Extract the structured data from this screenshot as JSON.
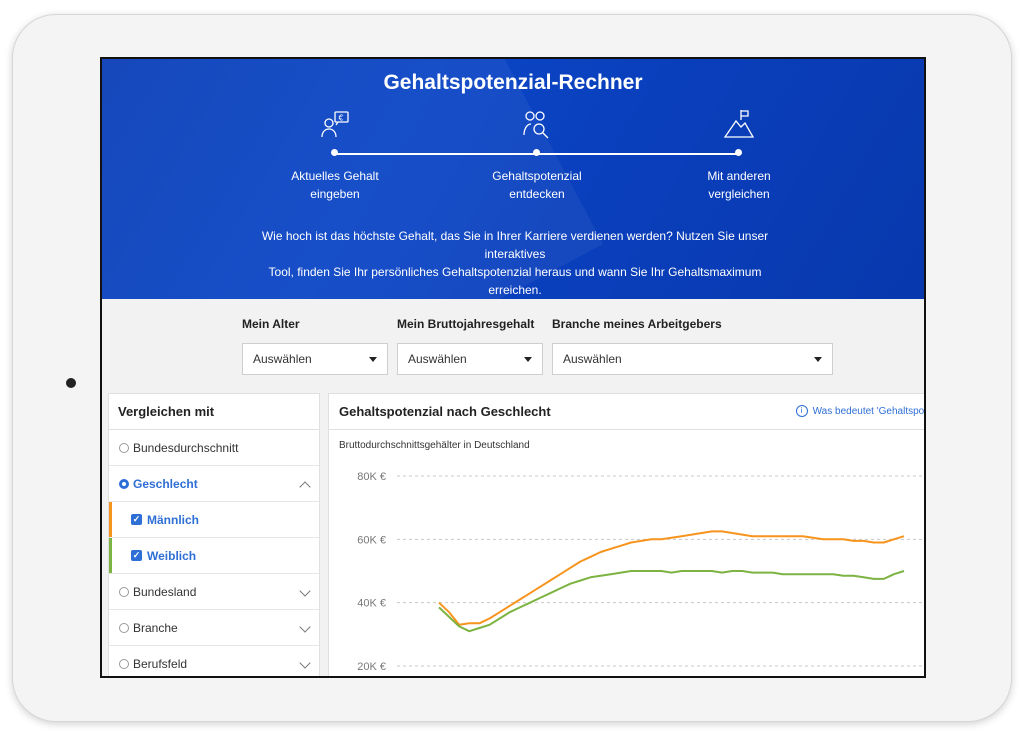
{
  "hero": {
    "title": "Gehaltspotenzial-Rechner",
    "steps": [
      {
        "icon": "person-euro-icon",
        "label_line1": "Aktuelles Gehalt",
        "label_line2": "eingeben"
      },
      {
        "icon": "people-search-icon",
        "label_line1": "Gehaltspotenzial",
        "label_line2": "entdecken"
      },
      {
        "icon": "mountain-flag-icon",
        "label_line1": "Mit anderen",
        "label_line2": "vergleichen"
      }
    ],
    "description_line1": "Wie hoch ist das höchste Gehalt, das Sie in Ihrer Karriere verdienen werden? Nutzen Sie unser interaktives",
    "description_line2": "Tool, finden Sie Ihr persönliches Gehaltspotenzial heraus und wann Sie Ihr Gehaltsmaximum erreichen."
  },
  "filters": [
    {
      "label": "Mein Alter",
      "value": "Auswählen"
    },
    {
      "label": "Mein Bruttojahresgehalt",
      "value": "Auswählen"
    },
    {
      "label": "Branche meines Arbeitgebers",
      "value": "Auswählen"
    }
  ],
  "sidebar": {
    "title": "Vergleichen mit",
    "items": [
      {
        "label": "Bundesdurchschnitt"
      },
      {
        "label": "Geschlecht"
      },
      {
        "label": "Männlich",
        "color": "#f7941d"
      },
      {
        "label": "Weiblich",
        "color": "#7cb342"
      },
      {
        "label": "Bundesland"
      },
      {
        "label": "Branche"
      },
      {
        "label": "Berufsfeld"
      }
    ]
  },
  "panel": {
    "title": "Gehaltspotenzial nach Geschlecht",
    "info_link": "Was bedeutet 'Gehaltspot",
    "subtitle": "Bruttodurchschnittsgehälter in Deutschland"
  },
  "chart_data": {
    "type": "line",
    "ylim": [
      20000,
      80000
    ],
    "yticks": [
      {
        "value": 80000,
        "label": "80K €"
      },
      {
        "value": 60000,
        "label": "60K €"
      },
      {
        "value": 40000,
        "label": "40K €"
      },
      {
        "value": 20000,
        "label": "20K €"
      }
    ],
    "grid": true,
    "x": [
      0,
      1,
      2,
      3,
      4,
      5,
      6,
      7,
      8,
      9,
      10,
      11,
      12,
      13,
      14,
      15,
      16,
      17,
      18,
      19,
      20,
      21,
      22,
      23,
      24,
      25,
      26,
      27,
      28,
      29,
      30,
      31,
      32,
      33,
      34,
      35,
      36,
      37,
      38,
      39,
      40,
      41,
      42,
      43,
      44,
      45,
      46
    ],
    "series": [
      {
        "color": "#f7941d",
        "values": [
          40000,
          37000,
          33000,
          33500,
          33500,
          35000,
          37000,
          39000,
          41000,
          43000,
          45000,
          47000,
          49000,
          51000,
          53000,
          54500,
          56000,
          57000,
          58000,
          59000,
          59500,
          60000,
          60000,
          60500,
          61000,
          61500,
          62000,
          62500,
          62500,
          62000,
          61500,
          61000,
          61000,
          61000,
          61000,
          61000,
          61000,
          60500,
          60000,
          60000,
          60000,
          59500,
          59500,
          59000,
          59000,
          60000,
          61000
        ]
      },
      {
        "color": "#7cb342",
        "values": [
          38500,
          35500,
          32500,
          31000,
          32000,
          33000,
          35000,
          37000,
          38500,
          40000,
          41500,
          43000,
          44500,
          46000,
          47000,
          48000,
          48500,
          49000,
          49500,
          50000,
          50000,
          50000,
          50000,
          49500,
          50000,
          50000,
          50000,
          50000,
          49500,
          50000,
          50000,
          49500,
          49500,
          49500,
          49000,
          49000,
          49000,
          49000,
          49000,
          49000,
          48500,
          48500,
          48000,
          47500,
          47500,
          49000,
          50000
        ]
      }
    ]
  }
}
